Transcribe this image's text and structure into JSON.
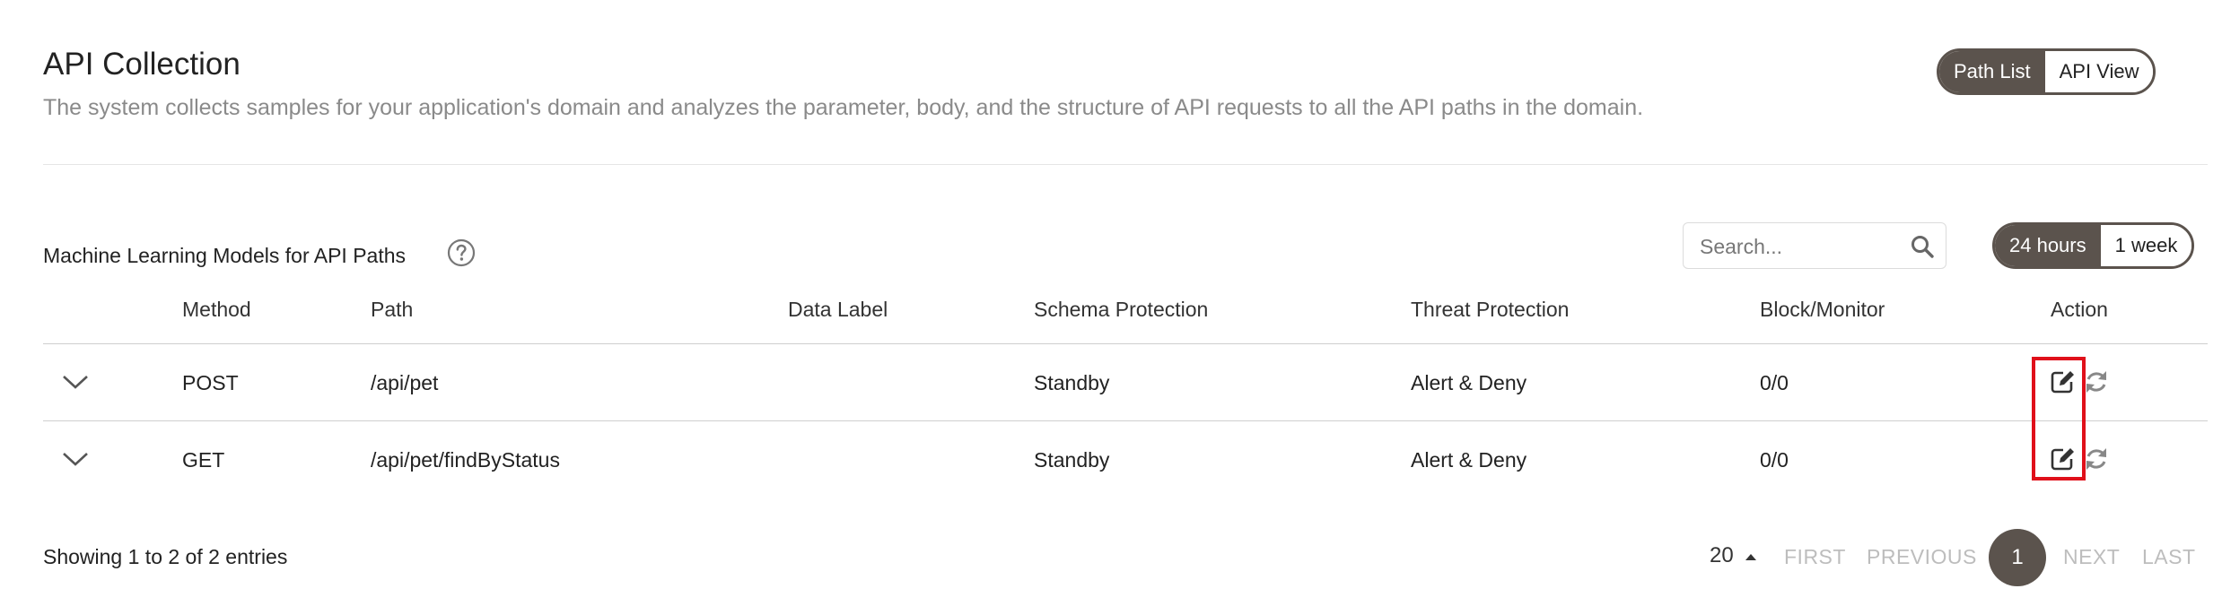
{
  "header": {
    "title": "API Collection",
    "description": "The system collects samples for your application's domain and analyzes the parameter, body, and the structure of API requests to all the API paths in the domain.",
    "view_toggle": [
      {
        "label": "Path List",
        "active": true
      },
      {
        "label": "API View",
        "active": false
      }
    ]
  },
  "section": {
    "title": "Machine Learning Models for API Paths",
    "search_placeholder": "Search...",
    "time_toggle": [
      {
        "label": "24 hours",
        "active": true
      },
      {
        "label": "1 week",
        "active": false
      }
    ]
  },
  "table": {
    "columns": [
      "Method",
      "Path",
      "Data Label",
      "Schema Protection",
      "Threat Protection",
      "Block/Monitor",
      "Action"
    ],
    "rows": [
      {
        "method": "POST",
        "path": "/api/pet",
        "data_label": "",
        "schema_protection": "Standby",
        "threat_protection": "Alert & Deny",
        "block_monitor": "0/0"
      },
      {
        "method": "GET",
        "path": "/api/pet/findByStatus",
        "data_label": "",
        "schema_protection": "Standby",
        "threat_protection": "Alert & Deny",
        "block_monitor": "0/0"
      }
    ]
  },
  "footer": {
    "entries_text": "Showing 1 to 2 of 2 entries",
    "page_size": "20",
    "first": "FIRST",
    "previous": "PREVIOUS",
    "current_page": "1",
    "next": "NEXT",
    "last": "LAST"
  },
  "colors": {
    "accent": "#5b534d",
    "highlight": "#e0101a"
  }
}
